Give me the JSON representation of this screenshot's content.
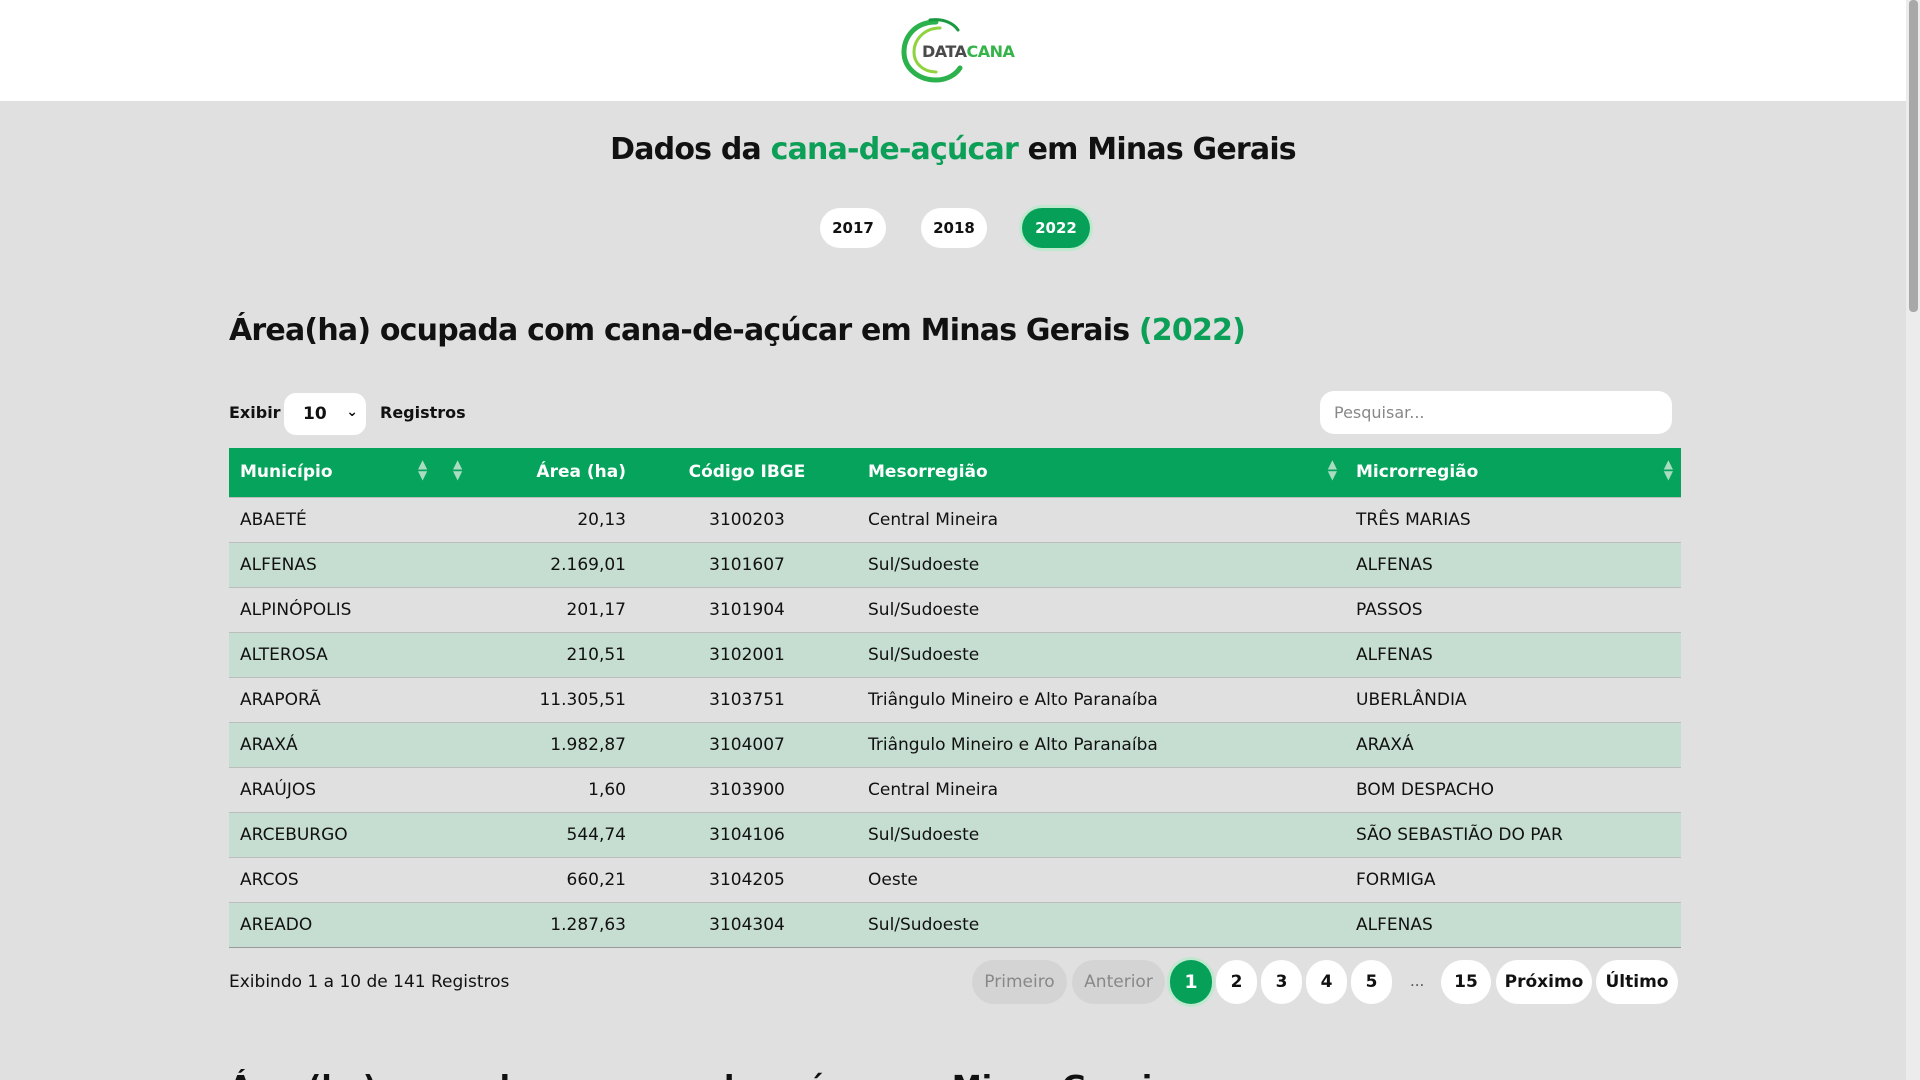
{
  "brand": {
    "logo_part1": "DATA",
    "logo_part2": "CANA",
    "color_primary": "#06a059"
  },
  "title": {
    "prefix": "Dados da ",
    "accent": "cana-de-açúcar",
    "suffix": " em Minas Gerais"
  },
  "years": [
    {
      "label": "2017",
      "active": false
    },
    {
      "label": "2018",
      "active": false
    },
    {
      "label": "2022",
      "active": true
    }
  ],
  "section": {
    "title_main": "Área(ha) ocupada com cana-de-açúcar em Minas Gerais ",
    "title_year": "(2022)"
  },
  "controls": {
    "show_label": "Exibir",
    "page_length": "10",
    "records_label": "Registros",
    "search_placeholder": "Pesquisar..."
  },
  "table": {
    "headers": [
      "Município",
      "Área (ha)",
      "Código IBGE",
      "Mesorregião",
      "Microrregião"
    ],
    "rows": [
      [
        "ABAETÉ",
        "20,13",
        "3100203",
        "Central Mineira",
        "TRÊS MARIAS"
      ],
      [
        "ALFENAS",
        "2.169,01",
        "3101607",
        "Sul/Sudoeste",
        "ALFENAS"
      ],
      [
        "ALPINÓPOLIS",
        "201,17",
        "3101904",
        "Sul/Sudoeste",
        "PASSOS"
      ],
      [
        "ALTEROSA",
        "210,51",
        "3102001",
        "Sul/Sudoeste",
        "ALFENAS"
      ],
      [
        "ARAPORÃ",
        "11.305,51",
        "3103751",
        "Triângulo Mineiro e Alto Paranaíba",
        "UBERLÂNDIA"
      ],
      [
        "ARAXÁ",
        "1.982,87",
        "3104007",
        "Triângulo Mineiro e Alto Paranaíba",
        "ARAXÁ"
      ],
      [
        "ARAÚJOS",
        "1,60",
        "3103900",
        "Central Mineira",
        "BOM DESPACHO"
      ],
      [
        "ARCEBURGO",
        "544,74",
        "3104106",
        "Sul/Sudoeste",
        "SÃO SEBASTIÃO DO PAR"
      ],
      [
        "ARCOS",
        "660,21",
        "3104205",
        "Oeste",
        "FORMIGA"
      ],
      [
        "AREADO",
        "1.287,63",
        "3104304",
        "Sul/Sudoeste",
        "ALFENAS"
      ]
    ]
  },
  "footer": {
    "info": "Exibindo 1 a 10 de 141 Registros",
    "first": "Primeiro",
    "prev": "Anterior",
    "pages": [
      "1",
      "2",
      "3",
      "4",
      "5"
    ],
    "ellipsis": "...",
    "last_page": "15",
    "next": "Próximo",
    "last": "Último"
  }
}
